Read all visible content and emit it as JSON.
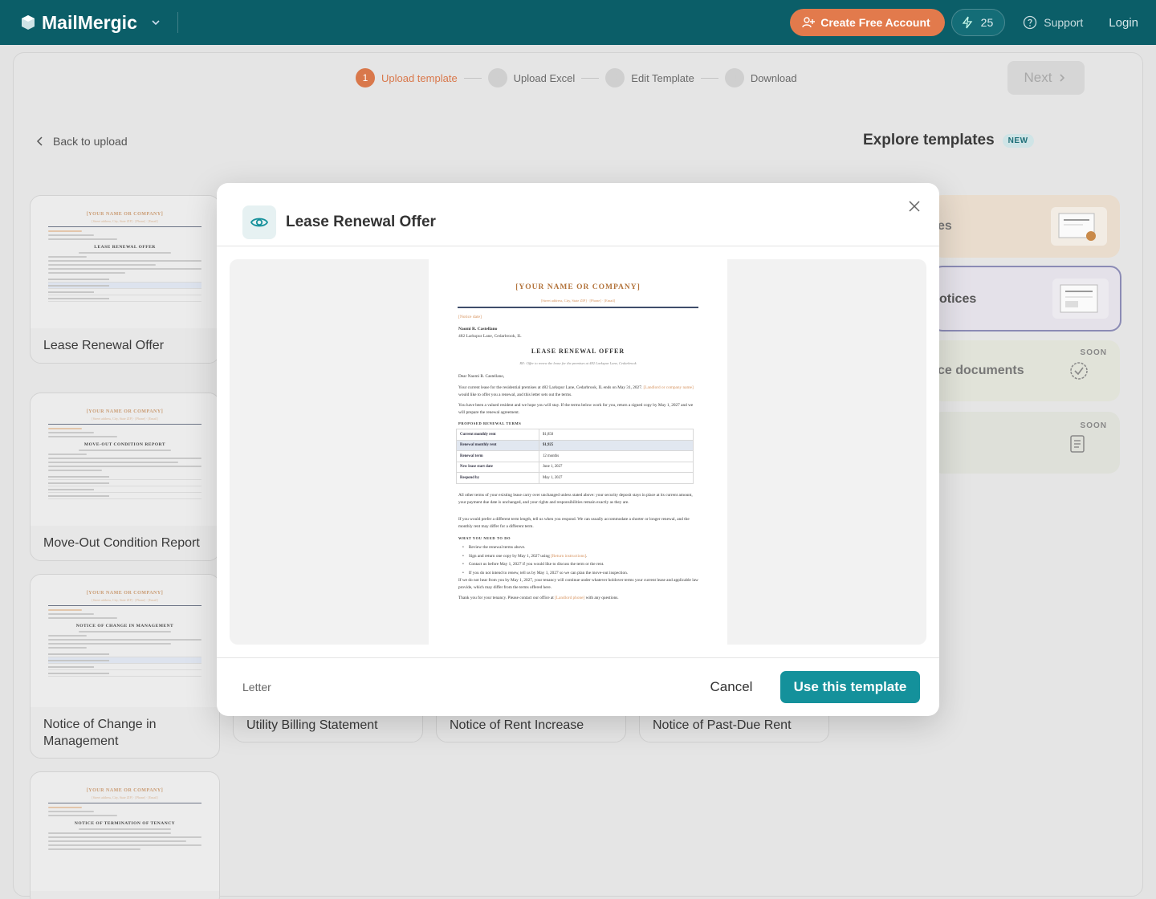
{
  "topbar": {
    "brand": "MailMergic",
    "create_account": "Create Free Account",
    "credits": "25",
    "support": "Support",
    "login": "Login"
  },
  "steps": [
    {
      "num": "1",
      "label": "Upload template"
    },
    {
      "num": "2",
      "label": "Upload Excel"
    },
    {
      "num": "3",
      "label": "Edit Template"
    },
    {
      "num": "4",
      "label": "Download"
    }
  ],
  "next": "Next",
  "back": "Back to upload",
  "explore": {
    "title": "Explore templates",
    "badge": "NEW"
  },
  "side": [
    {
      "title": "es"
    },
    {
      "title": "otices"
    },
    {
      "title": "ce documents",
      "soon": "SOON"
    },
    {
      "title": "",
      "soon": "SOON"
    }
  ],
  "cards": [
    {
      "title": "Lease Renewal Offer",
      "doc": "LEASE RENEWAL OFFER"
    },
    {
      "title": "Move-Out Condition Report",
      "doc": "MOVE-OUT CONDITION REPORT"
    },
    {
      "title": "Notice of Change in Management",
      "doc": "NOTICE OF CHANGE IN MANAGEMENT"
    },
    {
      "title": "",
      "doc": "NOTICE OF TERMINATION OF TENANCY"
    }
  ],
  "bottom_cards": [
    "Utility Billing Statement",
    "Notice of Rent Increase",
    "Notice of Past-Due Rent"
  ],
  "mini_header": "[YOUR NAME OR COMPANY]",
  "modal": {
    "title": "Lease Renewal Offer",
    "format": "Letter",
    "cancel": "Cancel",
    "use": "Use this template",
    "doc": {
      "header": "[YOUR NAME OR COMPANY]",
      "subheader": "[Street address, City, State ZIP] · [Phone] · [Email]",
      "notice_date": "[Notice date]",
      "recipient": "Naomi R. Castellano",
      "address": "482 Larkspur Lane, Cedarbrook, IL",
      "title": "LEASE RENEWAL OFFER",
      "re": "RE: Offer to renew the lease for the premises at 482 Larkspur Lane, Cedarbrook",
      "greeting": "Dear Naomi R. Castellano,",
      "p1a": "Your current lease for the residential premises at 482 Larkspur Lane, Cedarbrook, IL ends on May 31, 2027.",
      "p1b": "[Landlord or company name]",
      "p1c": " would like to offer you a renewal, and this letter sets out the terms.",
      "p2": "You have been a valued resident and we hope you will stay. If the terms below work for you, return a signed copy by May 1, 2027 and we will prepare the renewal agreement.",
      "terms_heading": "PROPOSED RENEWAL TERMS",
      "terms": [
        {
          "label": "Current monthly rent",
          "value": "$1,850"
        },
        {
          "label": "Renewal monthly rent",
          "value": "$1,925"
        },
        {
          "label": "Renewal term",
          "value": "12 months"
        },
        {
          "label": "New lease start date",
          "value": "June 1, 2027"
        },
        {
          "label": "Respond by",
          "value": "May 1, 2027"
        }
      ],
      "p3": "All other terms of your existing lease carry over unchanged unless stated above: your security deposit stays in place at its current amount, your payment due date is unchanged, and your rights and responsibilities remain exactly as they are.",
      "p4": "If you would prefer a different term length, tell us when you respond. We can usually accommodate a shorter or longer renewal, and the monthly rent may differ for a different term.",
      "todo_heading": "WHAT YOU NEED TO DO",
      "todo1": "Review the renewal terms above.",
      "todo2a": "Sign and return one copy by May 1, 2027 using ",
      "todo2b": "[Return instructions]",
      "todo3": "Contact us before May 1, 2027 if you would like to discuss the term or the rent.",
      "todo4": "If you do not intend to renew, tell us by May 1, 2027 so we can plan the move-out inspection.",
      "p5": "If we do not hear from you by May 1, 2027, your tenancy will continue under whatever holdover terms your current lease and applicable law provide, which may differ from the terms offered here.",
      "p6a": "Thank you for your tenancy. Please contact our office at ",
      "p6b": "[Landlord phone]",
      "p6c": " with any questions."
    }
  }
}
